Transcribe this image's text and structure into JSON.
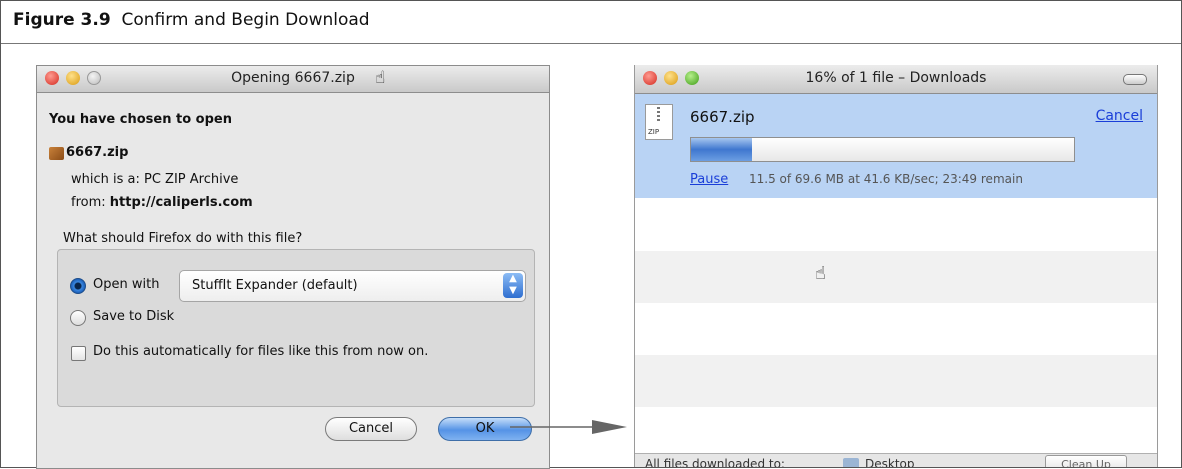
{
  "figure": {
    "label": "Figure 3.9",
    "caption": "Confirm and Begin Download"
  },
  "open_dialog": {
    "title": "Opening 6667.zip",
    "heading": "You have chosen to open",
    "file_name": "6667.zip",
    "type_line": "which is a: PC ZIP Archive",
    "from_label": "from:",
    "from_url": "http://caliperls.com",
    "question": "What should Firefox do with this file?",
    "open_with_label": "Open with",
    "open_with_app": "StuffIt Expander (default)",
    "save_label": "Save to Disk",
    "auto_label": "Do this automatically for files like this from now on.",
    "cancel_label": "Cancel",
    "ok_label": "OK",
    "selected_option": "open_with",
    "auto_checked": false
  },
  "downloads": {
    "title": "16% of 1 file – Downloads",
    "item_name": "6667.zip",
    "zip_badge": "ZIP",
    "cancel_label": "Cancel",
    "progress_percent": 16,
    "pause_label": "Pause",
    "status": "11.5 of 69.6 MB at 41.6 KB/sec; 23:49 remain",
    "footer_label": "All files downloaded to:",
    "footer_folder": "Desktop",
    "cleanup_label": "Clean Up"
  },
  "colors": {
    "accent_blue": "#3f77cf",
    "selected_row": "#b9d3f4",
    "link": "#1a3ed8"
  },
  "icons": [
    "pointer-hand-icon",
    "zip-file-icon",
    "folder-icon",
    "stuffit-icon"
  ]
}
